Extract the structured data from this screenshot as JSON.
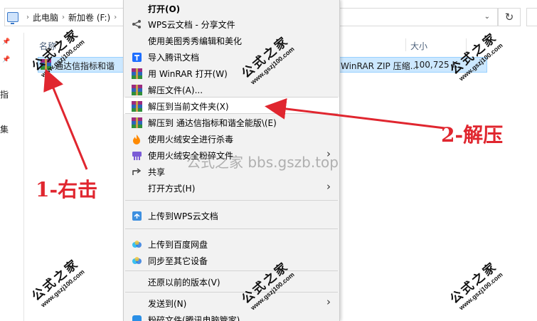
{
  "addressbar": {
    "segments": [
      "此电脑",
      "新加卷 (F:)"
    ],
    "refresh_icon": "refresh-icon"
  },
  "navpane": {
    "texts": [
      "指",
      "集"
    ]
  },
  "filelist": {
    "columns": {
      "name": "名称",
      "size": "大小"
    },
    "selected_row": {
      "name": "通达信指标和谐",
      "type": "WinRAR ZIP 压缩...",
      "size": "100,725 K"
    }
  },
  "context_menu": {
    "items": [
      {
        "label": "打开(O)",
        "icon": "none",
        "bold": true
      },
      {
        "label": "WPS云文档 - 分享文件",
        "icon": "share-icon"
      },
      {
        "label": "使用美图秀秀编辑和美化",
        "icon": "none"
      },
      {
        "label": "导入腾讯文档",
        "icon": "tencent-docs-icon"
      },
      {
        "label": "用 WinRAR 打开(W)",
        "icon": "winrar-icon"
      },
      {
        "label": "解压文件(A)...",
        "icon": "winrar-icon"
      },
      {
        "label": "解压到当前文件夹(X)",
        "icon": "winrar-icon"
      },
      {
        "label": "解压到 通达信指标和谐全能版\\(E)",
        "icon": "winrar-icon"
      },
      {
        "label": "使用火绒安全进行杀毒",
        "icon": "huorong-icon"
      },
      {
        "label": "使用火绒安全粉碎文件",
        "icon": "shredder-icon"
      },
      {
        "label": "共享",
        "icon": "share-arrow-icon"
      },
      {
        "label": "打开方式(H)",
        "icon": "none"
      },
      {
        "label": "上传到WPS云文档",
        "icon": "wps-cloud-icon"
      },
      {
        "label": "上传到百度网盘",
        "icon": "baidu-netdisk-icon"
      },
      {
        "label": "同步至其它设备",
        "icon": "baidu-netdisk-icon"
      },
      {
        "label": "还原以前的版本(V)",
        "icon": "none"
      },
      {
        "label": "发送到(N)",
        "icon": "none"
      },
      {
        "label": "粉碎文件(腾讯电脑管家)",
        "icon": "tencent-pcmgr-icon"
      }
    ]
  },
  "watermarks": {
    "brand": "公式之家",
    "url": "www.gszj100.com",
    "center": "公式之家 bbs.gszb.top"
  },
  "annotations": {
    "step1": "1-右击",
    "step2": "2-解压",
    "color": "#e0262f"
  },
  "colors": {
    "selection": "#cce8ff",
    "menu_bg": "#f2f2f2"
  }
}
